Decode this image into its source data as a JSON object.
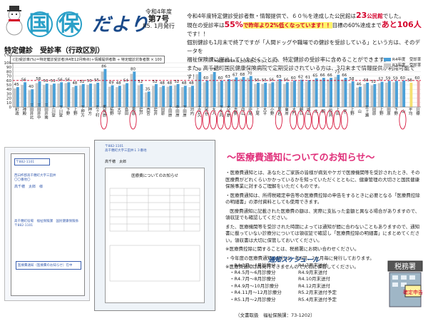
{
  "header": {
    "title_chars": [
      "国",
      "保"
    ],
    "title_suffix": "だより",
    "issue_era": "令和4年度",
    "issue_number": "第7号",
    "issue_date": "R5. 1月発行"
  },
  "intro": {
    "line1_pre": "令和4年度特定健診受診者数・情報提供で、６０％を達成した公民館は",
    "line1_num": "23",
    "line1_unit": "公民館",
    "line1_post": "でした。",
    "line2_pre": "現在の受診率は",
    "line2_rate": "55%",
    "line2_mid": "で昨年より2%低くなっています！！",
    "line2_target": "目標の60%達成まで",
    "line2_remaining": "あと106人",
    "line2_post": "です！！",
    "line3": "個別健診も1月末で終了ですが「人間ドッグや職場での健診を受診している」という方は、そのデータを",
    "line4": "福祉保険課に提出していただくことで、特定健診の受診率に含めることができます。",
    "line5": "また、高千穂町国民健康保険病院で定期受診されている方は、3月末まで情報提供が利用可能です！"
  },
  "chart_data": {
    "type": "bar",
    "title": "特定健診　受診率（行政区別）",
    "unit_label": "(%)",
    "note": "(注)受診率(%)＝特定健診受診者(R4年12月時点)＋情報提供者数 ÷ 特定健診対象者数 × 100",
    "target_note": "※受診率60％以上は赤色で示しています",
    "ylim": [
      0,
      100
    ],
    "yticks": [
      0,
      10,
      20,
      30,
      40,
      50,
      60,
      70,
      80,
      90,
      100
    ],
    "target_line": 60,
    "series": [
      {
        "name": "R4年度　受診率",
        "color": "#4aa0d8"
      },
      {
        "name": "R3年度　受診率",
        "color": "#c8c8c8"
      }
    ],
    "categories": [
      "町政",
      "神殿",
      "三田井北",
      "三田井中",
      "三田井南",
      "上川登",
      "下川登",
      "下野",
      "上野",
      "下押方",
      "押方",
      "五ヶ村",
      "馬見原",
      "柘野",
      "大平",
      "島田",
      "黒原",
      "岩戸",
      "西宮",
      "岩井",
      "田原",
      "上田原",
      "中田原",
      "下田原",
      "河内",
      "土呂久",
      "尾谷",
      "大人",
      "下永内",
      "大平原",
      "吉野",
      "向山",
      "中尾",
      "上尾",
      "大平",
      "小野",
      "黒岩",
      "東岸",
      "大門",
      "朝日",
      "城山",
      "北",
      "朝",
      "三田井",
      "上田",
      "宮",
      "上野",
      "山",
      "五ヶ瀬",
      "田原",
      "上野",
      "田原",
      "下野",
      "山",
      "平均",
      "日標"
    ],
    "values_r4": [
      45,
      56,
      40,
      58,
      53,
      53,
      56,
      56,
      48,
      52,
      53,
      55,
      86,
      49,
      48,
      54,
      80,
      52,
      35,
      52,
      48,
      48,
      52,
      48,
      48,
      79,
      60,
      79,
      60,
      63,
      67,
      68,
      70,
      55,
      55,
      56,
      63,
      56,
      60,
      62,
      61,
      65,
      66,
      66,
      73,
      66,
      58,
      46,
      55,
      52,
      57,
      59,
      59,
      60,
      55,
      60
    ],
    "values_r3": [
      42,
      50,
      38,
      54,
      50,
      50,
      53,
      54,
      45,
      49,
      50,
      52,
      80,
      46,
      45,
      51,
      75,
      49,
      33,
      48,
      45,
      46,
      49,
      45,
      45,
      74,
      56,
      74,
      57,
      58,
      63,
      64,
      66,
      52,
      52,
      53,
      58,
      52,
      57,
      58,
      57,
      61,
      62,
      62,
      68,
      62,
      54,
      44,
      52,
      49,
      54,
      55,
      56,
      57,
      0,
      0
    ],
    "data_labels": [
      "45",
      "56",
      "",
      "58",
      "",
      "",
      "",
      "",
      "",
      "",
      "",
      "",
      "86",
      "",
      "",
      "",
      "80",
      "",
      "",
      "",
      "",
      "",
      "",
      "",
      "",
      "79",
      "",
      "79",
      "",
      "",
      "67",
      "68",
      "",
      "",
      "",
      "",
      "",
      "",
      "61",
      "",
      "63",
      "",
      "",
      "",
      "73",
      "",
      "",
      "",
      "",
      "",
      "",
      "",
      "",
      "",
      "55",
      "60"
    ]
  },
  "letter": {
    "label": "〒882-1101",
    "addr1": "西臼杵郡高千穂町大字三田井",
    "addr2": "〇〇番地〇",
    "name": "高千穂　太郎　様",
    "sender": "高千穂町役場　福祉保険課　国民健康保険係",
    "sender_addr": "〒882-1101",
    "window": "医療費通知（医療費のお知らせ）在中"
  },
  "doc": {
    "header_zip": "〒882-1101",
    "header_addr": "高千穂町大字三田井１３番地",
    "name": "高千穂　太郎",
    "title": "医療費についてのお知らせ"
  },
  "notice": {
    "title": "〜医療費通知についてのお知らせ〜",
    "p1": "・医療費通知とは、あなたとご家族の皆様が病気やケガで医療機関等を受診されたとき、その医療費がどれくらいかかっているかを知っていただくとともに、健康管理の大切さと国民健康保険事業に対するご理解をいただくものです。",
    "p2": "・医療費通知は、所得税確定申告等の医療費控除の申告をするときに必要となる「医療費控除の明細書」の添付資料としても使用できます。",
    "p3": "医療費通知に記載された医療費の額は、実際に支払った金額と異なる場合がありますので、領収証でも確認してください。",
    "p4": "また、医療機関等を受診された時期によっては通知が間に合わないこともありますので、通知書に載っていない診療分については領収証で確認し「医療費控除の明細書」にまとめてください。領収書は大切に保管しておいてください。",
    "p5": "※医療費控除に関することは、税務署にお問い合わせください。",
    "p6": "・今年度の医療費通知の発行は、年6回、2か月毎に発行しております。",
    "p7": "※医療費通知は再発行できませんので大切に保管してください。"
  },
  "schedule": {
    "title": "通知スケジュール",
    "rows": [
      [
        "・R4.3月〜4月診療分",
        "R4.7月末送付"
      ],
      [
        "・R4.5月〜6月診療分",
        "R4.9月末送付"
      ],
      [
        "・R4.7月〜8月診療分",
        "R4.10月末送付"
      ],
      [
        "・R4.9月〜10月診療分",
        "R4.12月末送付"
      ],
      [
        "・R4.11月〜12月診療分",
        "R5.2月末送付予定"
      ],
      [
        "・R5.1月〜2月診療分",
        "R5.4月末送付予定"
      ]
    ],
    "tax_office_label": "税務署",
    "tax_sign": "確定申告"
  },
  "footer": {
    "text": "（文書取扱　福祉保険課：73-1202）"
  }
}
